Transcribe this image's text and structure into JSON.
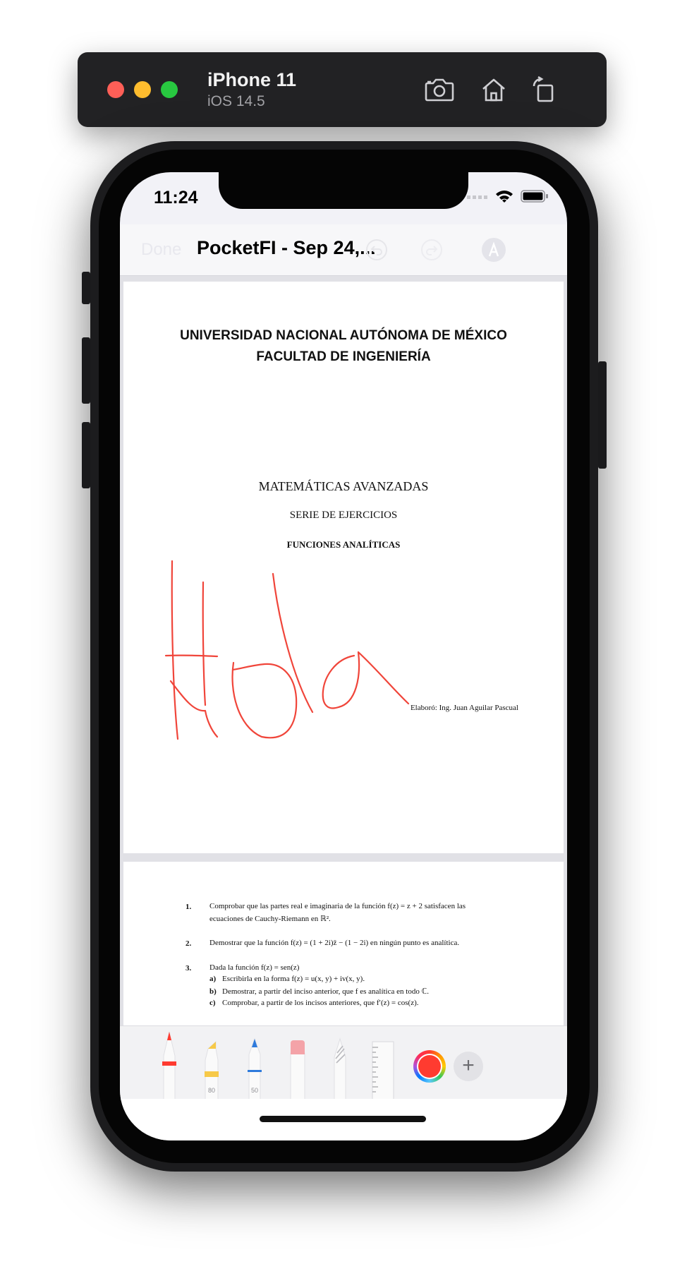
{
  "simulator": {
    "device_name": "iPhone 11",
    "os_version": "iOS 14.5",
    "buttons": [
      "screenshot-icon",
      "home-icon",
      "rotate-icon"
    ]
  },
  "status_bar": {
    "time": "11:24"
  },
  "nav_bar": {
    "done_label": "Done",
    "title": "PocketFI - Sep 24,...",
    "icons": [
      "undo-icon",
      "redo-icon",
      "markup-icon"
    ]
  },
  "document": {
    "page1": {
      "university": "UNIVERSIDAD NACIONAL AUTÓNOMA DE MÉXICO",
      "faculty": "FACULTAD DE INGENIERÍA",
      "subject": "MATEMÁTICAS AVANZADAS",
      "series": "SERIE DE EJERCICIOS",
      "topic": "FUNCIONES ANALÍTICAS",
      "author": "Elaboró: Ing. Juan Aguilar Pascual",
      "handwriting": "Hola"
    },
    "page2": {
      "exercises": [
        {
          "number": "1.",
          "text": "Comprobar que las partes real e imaginaria de la función f(z) = z + 2 satisfacen las",
          "text2": "ecuaciones de Cauchy-Riemann en ℝ²."
        },
        {
          "number": "2.",
          "text": "Demostrar que la función f(z) = (1 + 2i)z̄ − (1 − 2i) en ningún punto es analítica."
        },
        {
          "number": "3.",
          "text": "Dada la función f(z) = sen(z)"
        }
      ],
      "subitems": [
        {
          "letter": "a)",
          "text": "Escribirla en la forma f(z) = u(x, y) + iv(x, y)."
        },
        {
          "letter": "b)",
          "text": "Demostrar, a partir del inciso anterior, que f es analítica en todo ℂ."
        },
        {
          "letter": "c)",
          "text": "Comprobar, a partir de los incisos anteriores, que f′(z) = cos(z)."
        }
      ]
    }
  },
  "toolbar": {
    "tools": [
      {
        "name": "pen",
        "label": ""
      },
      {
        "name": "highlighter",
        "label": "80"
      },
      {
        "name": "pencil",
        "label": "50"
      },
      {
        "name": "eraser",
        "label": ""
      },
      {
        "name": "lasso",
        "label": ""
      },
      {
        "name": "ruler",
        "label": ""
      }
    ],
    "selected_color": "#ff3b30",
    "add_label": "+"
  }
}
